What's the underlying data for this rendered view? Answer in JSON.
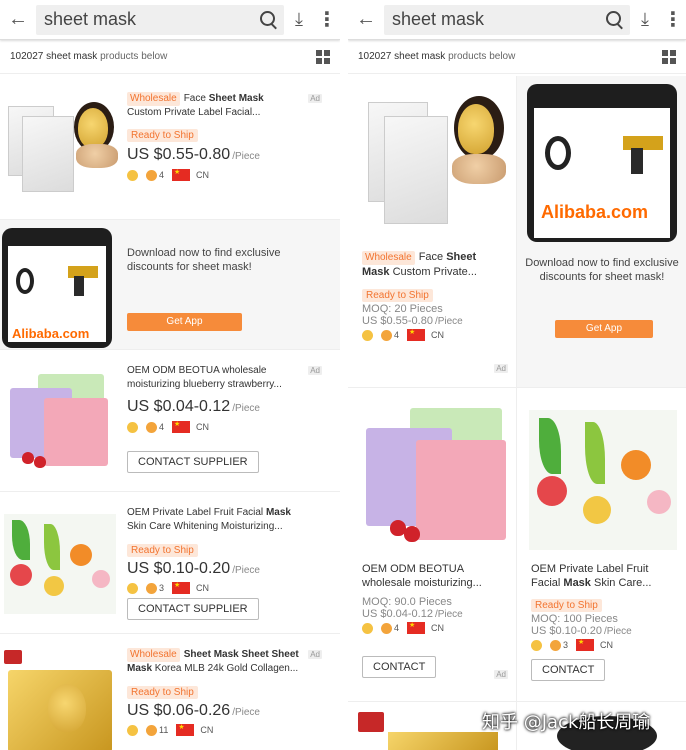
{
  "search": {
    "query": "sheet mask"
  },
  "count": {
    "number": "102027",
    "query": "sheet mask",
    "suffix": "products below"
  },
  "left_rows": [
    {
      "wholesale": "Wholesale",
      "title_pre": "Face ",
      "title_bold": "Sheet Mask",
      "title_post": "",
      "line2": "Custom Private Label Facial...",
      "rts": "Ready to Ship",
      "price": "US $0.55-0.80",
      "per": "/Piece",
      "years": "4",
      "country": "CN",
      "ad": "Ad"
    },
    {
      "promo_text": "Download now to find exclusive discounts for sheet mask!",
      "get_app": "Get App",
      "logo": "Alibaba.com"
    },
    {
      "title1": "OEM ODM BEOTUA wholesale",
      "line2": "moisturizing blueberry strawberry...",
      "price": "US $0.04-0.12",
      "per": "/Piece",
      "years": "4",
      "country": "CN",
      "contact": "CONTACT SUPPLIER",
      "ad": "Ad"
    },
    {
      "title_pre": "OEM Private Label Fruit Facial ",
      "title_bold": "Mask",
      "line2": "Skin Care Whitening Moisturizing...",
      "rts": "Ready to Ship",
      "price": "US $0.10-0.20",
      "per": "/Piece",
      "years": "3",
      "country": "CN",
      "contact": "CONTACT SUPPLIER"
    },
    {
      "wholesale": "Wholesale",
      "title_bold": "Sheet Mask Sheet Sheet",
      "line2_bold": "Mask",
      "line2": " Korea MLB 24k Gold Collagen...",
      "rts": "Ready to Ship",
      "price": "US $0.06-0.26",
      "per": "/Piece",
      "years": "11",
      "country": "CN",
      "ad": "Ad"
    }
  ],
  "right_cells": [
    {
      "wholesale": "Wholesale",
      "title_pre": "Face ",
      "title_bold": "Sheet",
      "line2_bold": "Mask",
      "line2": " Custom Private...",
      "rts": "Ready to Ship",
      "moq": "MOQ: 20 Pieces",
      "price": "US $0.55-0.80",
      "per": "/Piece",
      "years": "4",
      "country": "CN",
      "ad": "Ad"
    },
    {
      "promo_text": "Download now to find exclusive discounts for sheet mask!",
      "get_app": "Get App",
      "logo": "Alibaba.com"
    },
    {
      "title1": "OEM ODM BEOTUA",
      "line2": "wholesale moisturizing...",
      "moq": "MOQ: 90.0 Pieces",
      "price": "US $0.04-0.12",
      "per": "/Piece",
      "years": "4",
      "country": "CN",
      "contact": "CONTACT",
      "ad": "Ad"
    },
    {
      "title_pre": "OEM Private Label Fruit",
      "line2_pre": "Facial ",
      "line2_bold": "Mask",
      "line2": " Skin Care...",
      "rts": "Ready to Ship",
      "moq": "MOQ: 100 Pieces",
      "price": "US $0.10-0.20",
      "per": "/Piece",
      "years": "3",
      "country": "CN",
      "contact": "CONTACT"
    }
  ],
  "watermark": "知乎 @Jack船长周瑜",
  "colors": {
    "accent": "#f68b3a",
    "ready_bg": "#fde7d9",
    "ready_fg": "#f27430"
  }
}
